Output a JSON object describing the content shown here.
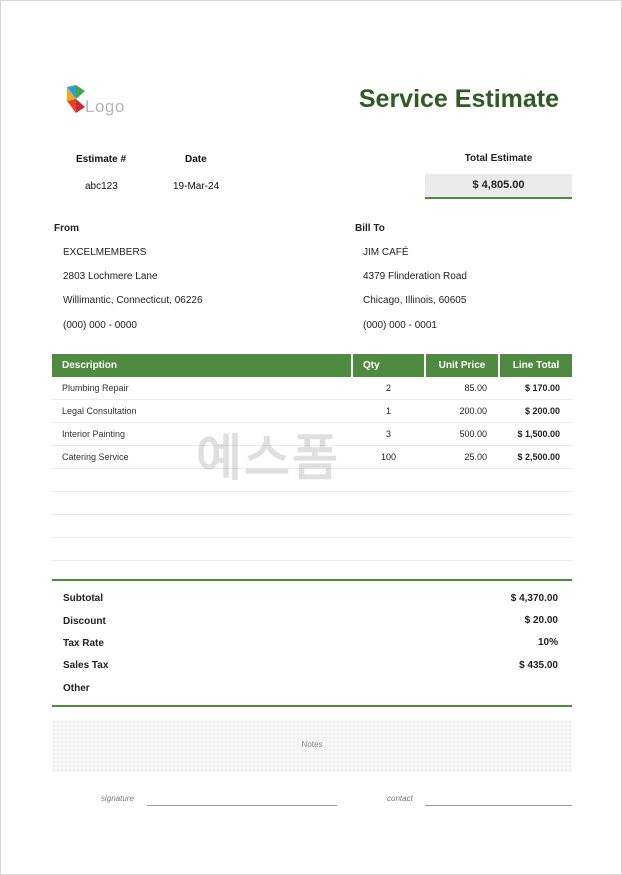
{
  "header": {
    "logo_text": "Logo",
    "title": "Service Estimate"
  },
  "meta": {
    "estimate_label": "Estimate #",
    "estimate_value": "abc123",
    "date_label": "Date",
    "date_value": "19-Mar-24",
    "total_label": "Total Estimate",
    "total_value": "$ 4,805.00"
  },
  "from": {
    "label": "From",
    "lines": [
      "EXCELMEMBERS",
      "2803 Lochmere Lane",
      "Willimantic, Connecticut, 06226",
      "(000) 000 - 0000"
    ]
  },
  "bill_to": {
    "label": "Bill To",
    "lines": [
      "JIM CAFÉ",
      "4379 Flinderation Road",
      "Chicago, Illinois, 60605",
      "(000) 000 - 0001"
    ]
  },
  "table": {
    "headers": [
      "Description",
      "Qty",
      "Unit Price",
      "Line Total"
    ],
    "rows": [
      {
        "description": "Plumbing Repair",
        "qty": "2",
        "unit_price": "85.00",
        "line_total": "$ 170.00"
      },
      {
        "description": "Legal Consultation",
        "qty": "1",
        "unit_price": "200.00",
        "line_total": "$ 200.00"
      },
      {
        "description": "Interior Painting",
        "qty": "3",
        "unit_price": "500.00",
        "line_total": "$ 1,500.00"
      },
      {
        "description": "Catering Service",
        "qty": "100",
        "unit_price": "25.00",
        "line_total": "$ 2,500.00"
      }
    ]
  },
  "summary": {
    "subtotal_label": "Subtotal",
    "subtotal_value": "$ 4,370.00",
    "discount_label": "Discount",
    "discount_value": "$ 20.00",
    "tax_rate_label": "Tax Rate",
    "tax_rate_value": "10%",
    "sales_tax_label": "Sales Tax",
    "sales_tax_value": "$ 435.00",
    "other_label": "Other"
  },
  "notes": {
    "label": "Notes"
  },
  "footer": {
    "signature_label": "signature",
    "contact_label": "contact"
  },
  "watermark": {
    "text": "예스폼"
  },
  "colors": {
    "accent": "#4e8a40",
    "title": "#2f5a24",
    "total_box_bg": "#ebebeb"
  }
}
